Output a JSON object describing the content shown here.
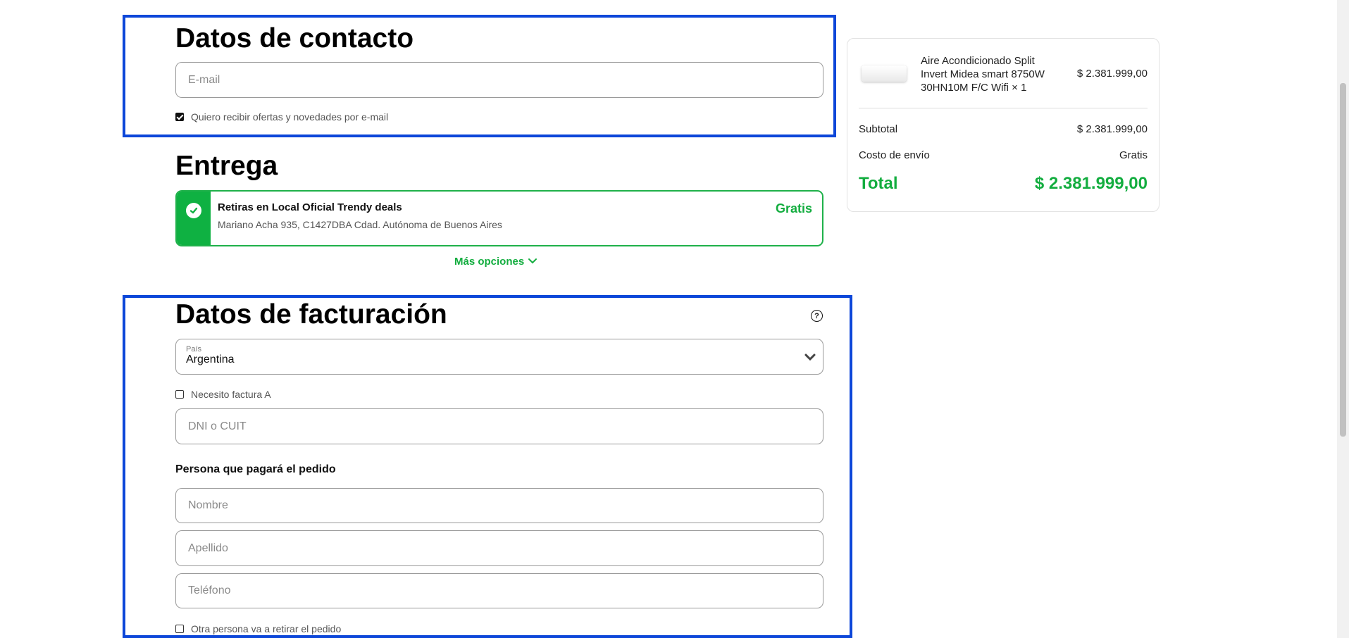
{
  "contact": {
    "title": "Datos de contacto",
    "email_placeholder": "E-mail",
    "newsletter_label": "Quiero recibir ofertas y novedades por e-mail",
    "newsletter_checked": true
  },
  "delivery": {
    "title": "Entrega",
    "option_name": "Retiras en Local Oficial Trendy deals",
    "option_address": "Mariano Acha 935, C1427DBA Cdad. Autónoma de Buenos Aires",
    "option_price": "Gratis",
    "more_options": "Más opciones"
  },
  "billing": {
    "title": "Datos de facturación",
    "country_label": "País",
    "country_value": "Argentina",
    "factura_a_label": "Necesito factura A",
    "dni_placeholder": "DNI o CUIT",
    "payer_heading": "Persona que pagará el pedido",
    "nombre_placeholder": "Nombre",
    "apellido_placeholder": "Apellido",
    "telefono_placeholder": "Teléfono",
    "other_person_label": "Otra persona va a retirar el pedido"
  },
  "summary": {
    "product_name_line1": "Aire Acondicionado Split",
    "product_name_line2": "Invert Midea smart 8750W",
    "product_name_line3": "30HN10M F/C Wifi × 1",
    "product_price": "$ 2.381.999,00",
    "subtotal_label": "Subtotal",
    "subtotal_value": "$ 2.381.999,00",
    "shipping_label": "Costo de envío",
    "shipping_value": "Gratis",
    "total_label": "Total",
    "total_value": "$ 2.381.999,00"
  },
  "colors": {
    "accent_green": "#13ad3f",
    "highlight_blue": "#0d47d9"
  },
  "icons": [
    "check-icon",
    "chevron-down-icon",
    "help-icon"
  ]
}
